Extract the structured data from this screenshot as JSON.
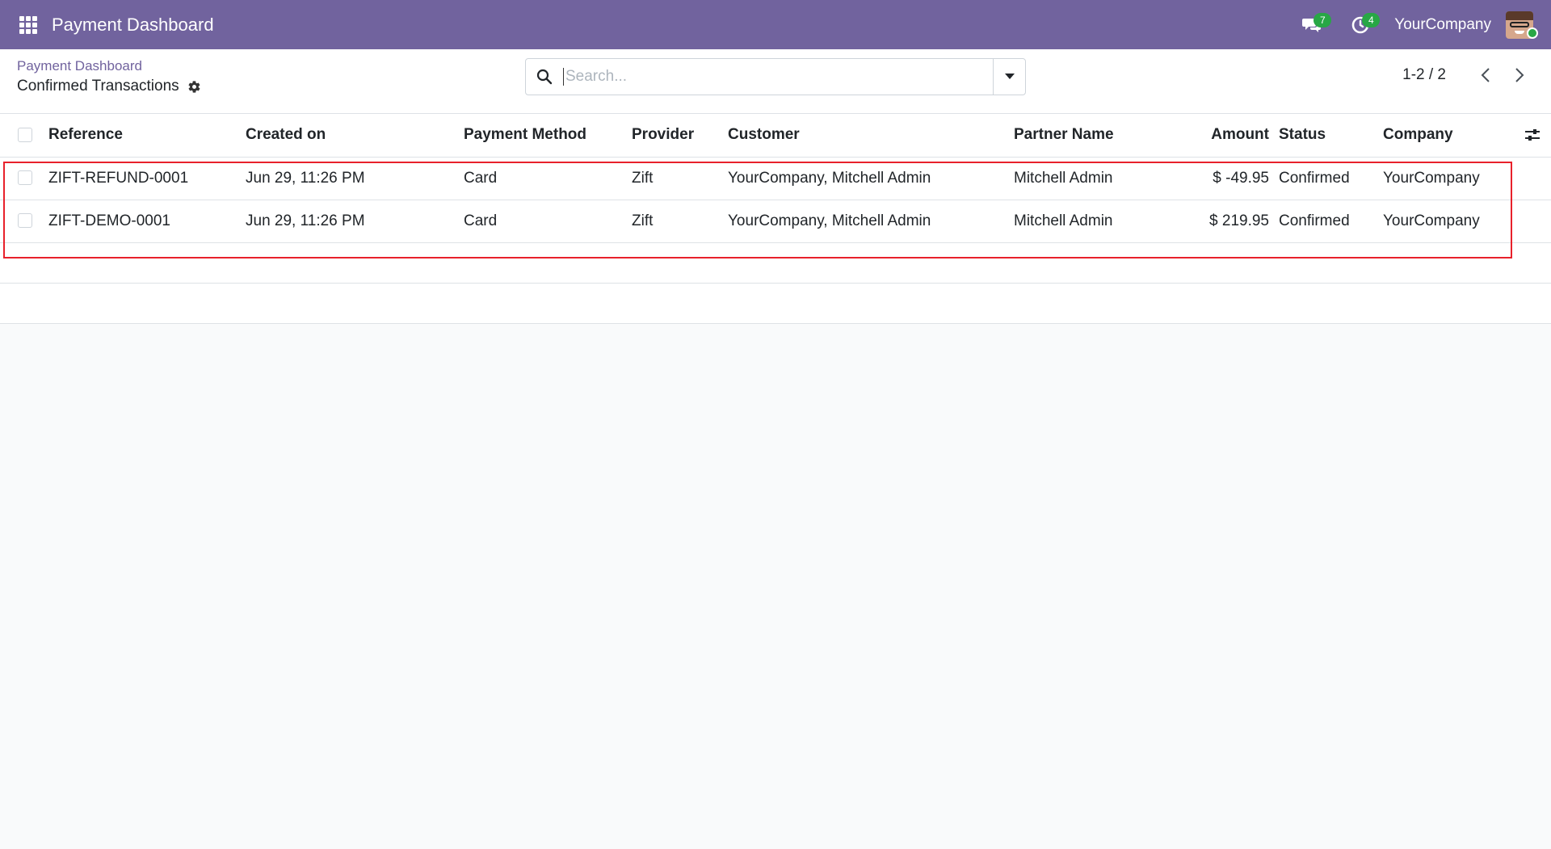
{
  "navbar": {
    "app_title": "Payment Dashboard",
    "messages_count": "7",
    "activities_count": "4",
    "company": "YourCompany",
    "accent_color": "#71639e",
    "icons": [
      "apps-grid-icon",
      "chat-bubbles-icon",
      "clock-icon",
      "avatar"
    ]
  },
  "control_panel": {
    "breadcrumb": "Payment Dashboard",
    "title": "Confirmed Transactions",
    "search_placeholder": "Search...",
    "pager": "1-2 / 2"
  },
  "table": {
    "columns": [
      "Reference",
      "Created on",
      "Payment Method",
      "Provider",
      "Customer",
      "Partner Name",
      "Amount",
      "Status",
      "Company"
    ],
    "rows": [
      {
        "reference": "ZIFT-REFUND-0001",
        "created_on": "Jun 29, 11:26 PM",
        "payment_method": "Card",
        "provider": "Zift",
        "customer": "YourCompany, Mitchell Admin",
        "partner_name": "Mitchell Admin",
        "amount": "$ -49.95",
        "status": "Confirmed",
        "company": "YourCompany"
      },
      {
        "reference": "ZIFT-DEMO-0001",
        "created_on": "Jun 29, 11:26 PM",
        "payment_method": "Card",
        "provider": "Zift",
        "customer": "YourCompany, Mitchell Admin",
        "partner_name": "Mitchell Admin",
        "amount": "$ 219.95",
        "status": "Confirmed",
        "company": "YourCompany"
      }
    ]
  },
  "highlight_color": "#e8212b"
}
